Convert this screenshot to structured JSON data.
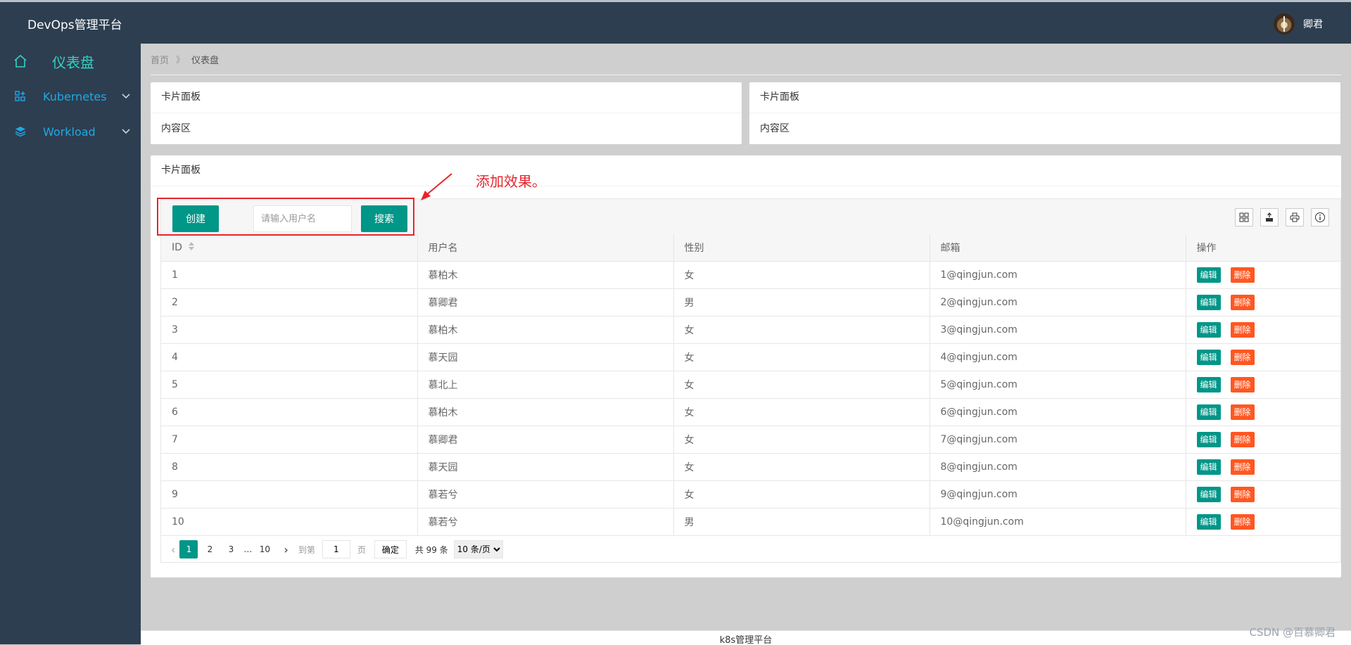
{
  "header": {
    "brand": "DevOps管理平台",
    "username": "卿君"
  },
  "sidebar": {
    "items": [
      {
        "label": "仪表盘",
        "icon": "home-icon"
      },
      {
        "label": "Kubernetes",
        "icon": "apps-icon"
      },
      {
        "label": "Workload",
        "icon": "layers-icon"
      }
    ]
  },
  "breadcrumb": {
    "home": "首页",
    "separator": "》",
    "current": "仪表盘"
  },
  "cards": [
    {
      "title": "卡片面板",
      "body": "内容区"
    },
    {
      "title": "卡片面板",
      "body": "内容区"
    }
  ],
  "table_card": {
    "title": "卡片面板"
  },
  "annotation": {
    "text": "添加效果。"
  },
  "toolbar": {
    "create_label": "创建",
    "search_placeholder": "请输入用户名",
    "search_label": "搜索"
  },
  "table": {
    "headers": [
      "ID",
      "用户名",
      "性别",
      "邮箱",
      "操作"
    ],
    "edit_label": "编辑",
    "delete_label": "删除",
    "rows": [
      [
        "1",
        "慕柏木",
        "女",
        "1@qingjun.com"
      ],
      [
        "2",
        "慕卿君",
        "男",
        "2@qingjun.com"
      ],
      [
        "3",
        "慕柏木",
        "女",
        "3@qingjun.com"
      ],
      [
        "4",
        "慕天园",
        "女",
        "4@qingjun.com"
      ],
      [
        "5",
        "慕北上",
        "女",
        "5@qingjun.com"
      ],
      [
        "6",
        "慕柏木",
        "女",
        "6@qingjun.com"
      ],
      [
        "7",
        "慕卿君",
        "女",
        "7@qingjun.com"
      ],
      [
        "8",
        "慕天园",
        "女",
        "8@qingjun.com"
      ],
      [
        "9",
        "慕若兮",
        "女",
        "9@qingjun.com"
      ],
      [
        "10",
        "慕若兮",
        "男",
        "10@qingjun.com"
      ]
    ]
  },
  "pager": {
    "pages": [
      "1",
      "2",
      "3"
    ],
    "ellipsis": "…",
    "last": "10",
    "goto_prefix": "到第",
    "goto_value": "1",
    "goto_suffix": "页",
    "confirm": "确定",
    "total": "共 99 条",
    "per_page": "10 条/页"
  },
  "footer": {
    "text": "k8s管理平台"
  },
  "watermark": "CSDN @百慕卿君",
  "colors": {
    "primary": "#009688",
    "danger": "#ff5722",
    "header_bg": "#2d3e50",
    "annotation": "#e8242d"
  }
}
